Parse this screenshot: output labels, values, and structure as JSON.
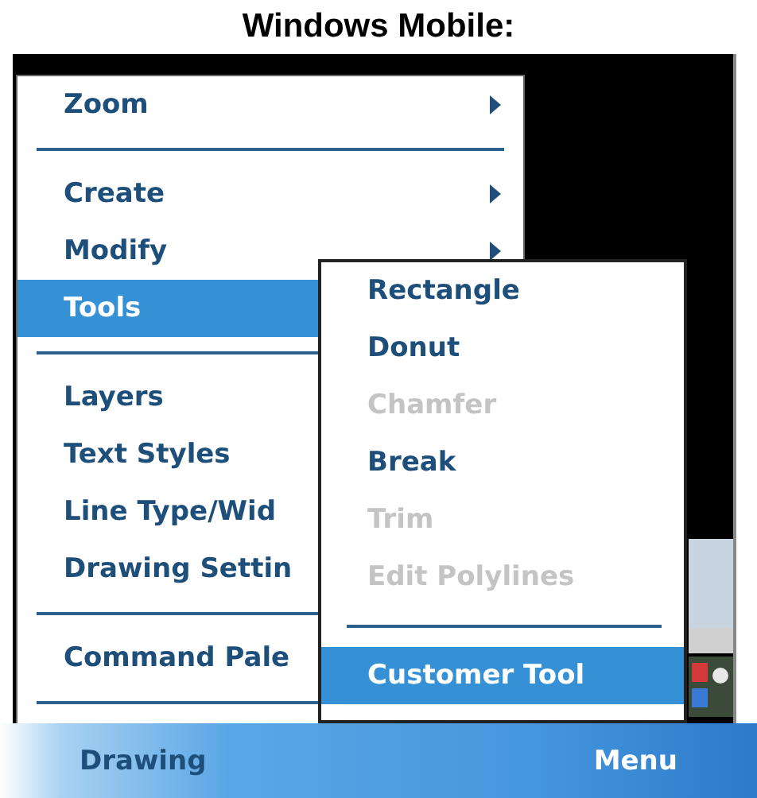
{
  "title": "Windows Mobile:",
  "menu": {
    "items": [
      {
        "kind": "item",
        "label": "Zoom",
        "submenu": true,
        "selected": false
      },
      {
        "kind": "separator"
      },
      {
        "kind": "item",
        "label": "Create",
        "submenu": true,
        "selected": false
      },
      {
        "kind": "item",
        "label": "Modify",
        "submenu": true,
        "selected": false
      },
      {
        "kind": "item",
        "label": "Tools",
        "selected": true
      },
      {
        "kind": "separator"
      },
      {
        "kind": "item",
        "label": "Layers",
        "selected": false
      },
      {
        "kind": "item",
        "label": "Text Styles",
        "selected": false
      },
      {
        "kind": "item",
        "label": "Line Type/Wid",
        "selected": false
      },
      {
        "kind": "item",
        "label": "Drawing Settin",
        "selected": false
      },
      {
        "kind": "separator"
      },
      {
        "kind": "item",
        "label": "Command Pale",
        "selected": false
      },
      {
        "kind": "separator"
      }
    ]
  },
  "submenu": {
    "items": [
      {
        "kind": "item",
        "label": "Rectangle",
        "disabled": false,
        "selected": false
      },
      {
        "kind": "item",
        "label": "Donut",
        "disabled": false,
        "selected": false
      },
      {
        "kind": "item",
        "label": "Chamfer",
        "disabled": true,
        "selected": false
      },
      {
        "kind": "item",
        "label": "Break",
        "disabled": false,
        "selected": false
      },
      {
        "kind": "item",
        "label": "Trim",
        "disabled": true,
        "selected": false
      },
      {
        "kind": "item",
        "label": "Edit Polylines",
        "disabled": true,
        "selected": false
      },
      {
        "kind": "separator"
      },
      {
        "kind": "item",
        "label": "Customer Tool",
        "disabled": false,
        "selected": true
      }
    ]
  },
  "softkeys": {
    "left": "Drawing",
    "right": "Menu"
  }
}
